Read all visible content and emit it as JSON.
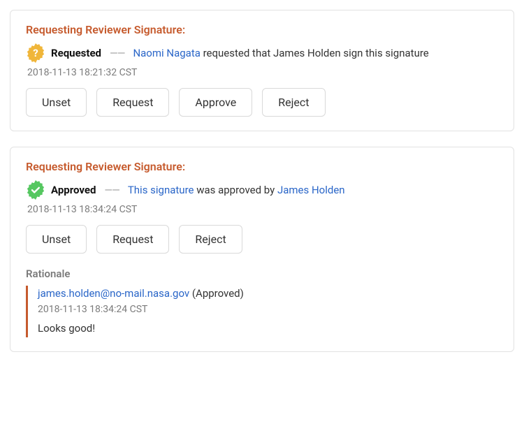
{
  "cards": [
    {
      "title": "Requesting Reviewer Signature:",
      "badge": "question",
      "badge_color": "#f0b63a",
      "status_label": "Requested",
      "segments": [
        {
          "kind": "link",
          "text": "Naomi Nagata"
        },
        {
          "kind": "text",
          "text": " requested that James Holden sign this signature"
        }
      ],
      "timestamp": "2018-11-13  18:21:32 CST",
      "buttons": [
        "Unset",
        "Request",
        "Approve",
        "Reject"
      ]
    },
    {
      "title": "Requesting Reviewer Signature:",
      "badge": "check",
      "badge_color": "#55c760",
      "status_label": "Approved",
      "segments": [
        {
          "kind": "link",
          "text": "This signature"
        },
        {
          "kind": "text",
          "text": " was approved by "
        },
        {
          "kind": "link",
          "text": "James Holden"
        }
      ],
      "timestamp": "2018-11-13  18:34:24 CST",
      "buttons": [
        "Unset",
        "Request",
        "Reject"
      ],
      "rationale": {
        "heading": "Rationale",
        "email": "james.holden@no-mail.nasa.gov",
        "status_suffix": "(Approved)",
        "timestamp": "2018-11-13  18:34:24 CST",
        "comment": "Looks good!"
      }
    }
  ]
}
